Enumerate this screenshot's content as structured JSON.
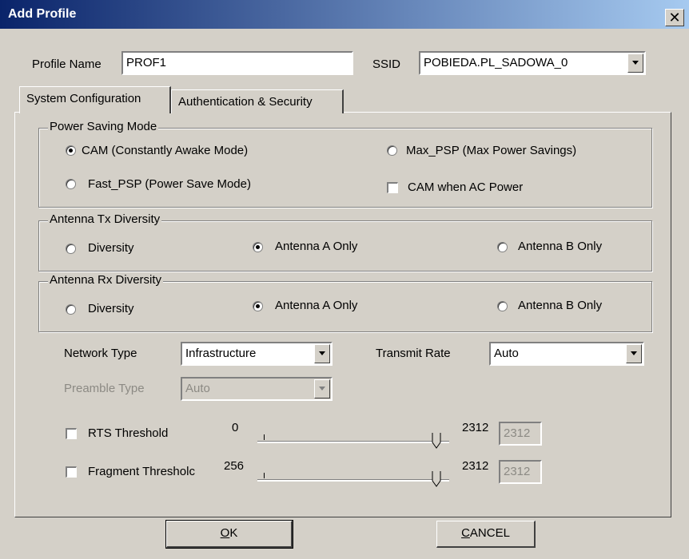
{
  "window": {
    "title": "Add Profile",
    "close_glyph": "✕"
  },
  "profile": {
    "name_label": "Profile Name",
    "name_value": "PROF1",
    "ssid_label": "SSID",
    "ssid_value": "POBIEDA.PL_SADOWA_0"
  },
  "tabs": [
    {
      "label": "System Configuration",
      "active": true
    },
    {
      "label": "Authentication & Security",
      "active": false
    }
  ],
  "power_saving": {
    "title": "Power Saving Mode",
    "cam": "CAM (Constantly Awake Mode)",
    "max_psp": "Max_PSP (Max Power Savings)",
    "fast_psp": "Fast_PSP (Power Save Mode)",
    "cam_ac": "CAM when AC Power",
    "selected": "cam"
  },
  "antenna_tx": {
    "title": "Antenna Tx Diversity",
    "diversity": "Diversity",
    "a_only": "Antenna A Only",
    "b_only": "Antenna B Only",
    "selected": "a_only"
  },
  "antenna_rx": {
    "title": "Antenna Rx Diversity",
    "diversity": "Diversity",
    "a_only": "Antenna A Only",
    "b_only": "Antenna B Only",
    "selected": "a_only"
  },
  "network": {
    "type_label": "Network Type",
    "type_value": "Infrastructure",
    "rate_label": "Transmit Rate",
    "rate_value": "Auto",
    "preamble_label": "Preamble Type",
    "preamble_value": "Auto"
  },
  "rts": {
    "label": "RTS Threshold",
    "min": "0",
    "max": "2312",
    "value": "2312"
  },
  "fragment": {
    "label": "Fragment Thresholc",
    "min": "256",
    "max": "2312",
    "value": "2312"
  },
  "buttons": {
    "ok_first": "O",
    "ok_rest": "K",
    "cancel_first": "C",
    "cancel_rest": "ANCEL"
  },
  "colors": {
    "title_gradient_start": "#0a246a",
    "title_gradient_end": "#a6caf0",
    "face": "#d4d0c8"
  }
}
